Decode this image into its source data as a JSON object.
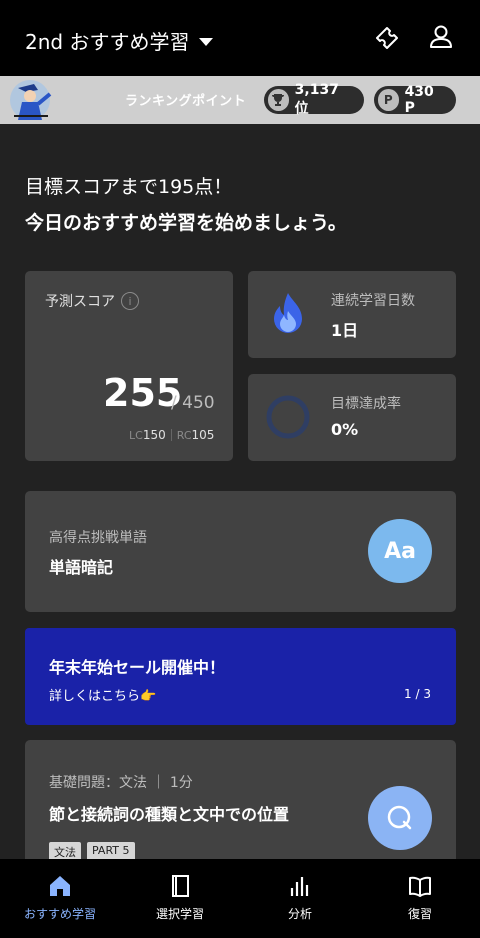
{
  "header": {
    "title": "2nd おすすめ学習",
    "icons": [
      "ticket-icon",
      "user-icon"
    ]
  },
  "ranking": {
    "label": "ランキングポイント",
    "rank": "3,137 位",
    "points": "430 P",
    "points_badge": "P"
  },
  "intro": {
    "line1": "目標スコアまで195点！",
    "line2": "今日のおすすめ学習を始めましょう。"
  },
  "predicted_score": {
    "label": "予測スコア",
    "info": "i",
    "score": "255",
    "max": "/ 450",
    "lc_label": "LC",
    "lc_value": "150",
    "rc_label": "RC",
    "rc_value": "105"
  },
  "streak": {
    "label": "連続学習日数",
    "value": "1日"
  },
  "goal": {
    "label": "目標達成率",
    "value": "0%",
    "progress": 0
  },
  "vocab": {
    "label": "高得点挑戦単語",
    "title": "単語暗記",
    "icon_text": "Aa"
  },
  "sale": {
    "title": "年末年始セール開催中！",
    "subtitle": "詳しくはこちら👉",
    "page": "1 / 3"
  },
  "grammar": {
    "label": "基礎問題：文法 ｜ 1分",
    "title": "節と接続詞の種類と文中での位置",
    "tags": [
      "文法",
      "PART 5"
    ]
  },
  "nav": [
    {
      "label": "おすすめ学習",
      "icon": "home-icon",
      "active": true
    },
    {
      "label": "選択学習",
      "icon": "book-icon",
      "active": false
    },
    {
      "label": "分析",
      "icon": "chart-icon",
      "active": false
    },
    {
      "label": "復習",
      "icon": "open-book-icon",
      "active": false
    }
  ],
  "colors": {
    "accent": "#8ab4ff",
    "sale_bg": "#1a22a8",
    "card_bg": "#424242"
  }
}
